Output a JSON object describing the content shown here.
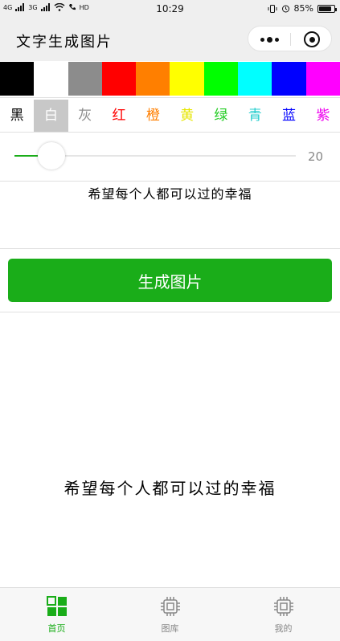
{
  "status_bar": {
    "signal_left": "4G",
    "signal_mid": "3G",
    "network": "HD",
    "time": "10:29",
    "battery": "85%",
    "battery_level": 0.85
  },
  "nav": {
    "title": "文字生成图片"
  },
  "colors": [
    {
      "label": "黑",
      "hex": "#000000",
      "text_color": "#000000"
    },
    {
      "label": "白",
      "hex": "#ffffff",
      "text_color": "#ffffff"
    },
    {
      "label": "灰",
      "hex": "#8c8c8c",
      "text_color": "#8c8c8c"
    },
    {
      "label": "红",
      "hex": "#ff0000",
      "text_color": "#ff0000"
    },
    {
      "label": "橙",
      "hex": "#ff7f00",
      "text_color": "#ff7f00"
    },
    {
      "label": "黄",
      "hex": "#ffff00",
      "text_color": "#e6e600"
    },
    {
      "label": "绿",
      "hex": "#00ff00",
      "text_color": "#22cc22"
    },
    {
      "label": "青",
      "hex": "#00ffff",
      "text_color": "#22cccc"
    },
    {
      "label": "蓝",
      "hex": "#0000ff",
      "text_color": "#0000ff"
    },
    {
      "label": "紫",
      "hex": "#ff00ff",
      "text_color": "#ee00ee"
    }
  ],
  "selected_color_index": 1,
  "slider": {
    "value": 20,
    "min": 12,
    "max": 100,
    "value_label": "20"
  },
  "input": {
    "text": "希望每个人都可以过的幸福"
  },
  "generate_button": {
    "label": "生成图片"
  },
  "preview": {
    "text": "希望每个人都可以过的幸福"
  },
  "tabs": [
    {
      "label": "首页",
      "icon": "grid-icon",
      "active": true
    },
    {
      "label": "图库",
      "icon": "chip-icon",
      "active": false
    },
    {
      "label": "我的",
      "icon": "chip-icon",
      "active": false
    }
  ],
  "accent_color": "#1aad19"
}
